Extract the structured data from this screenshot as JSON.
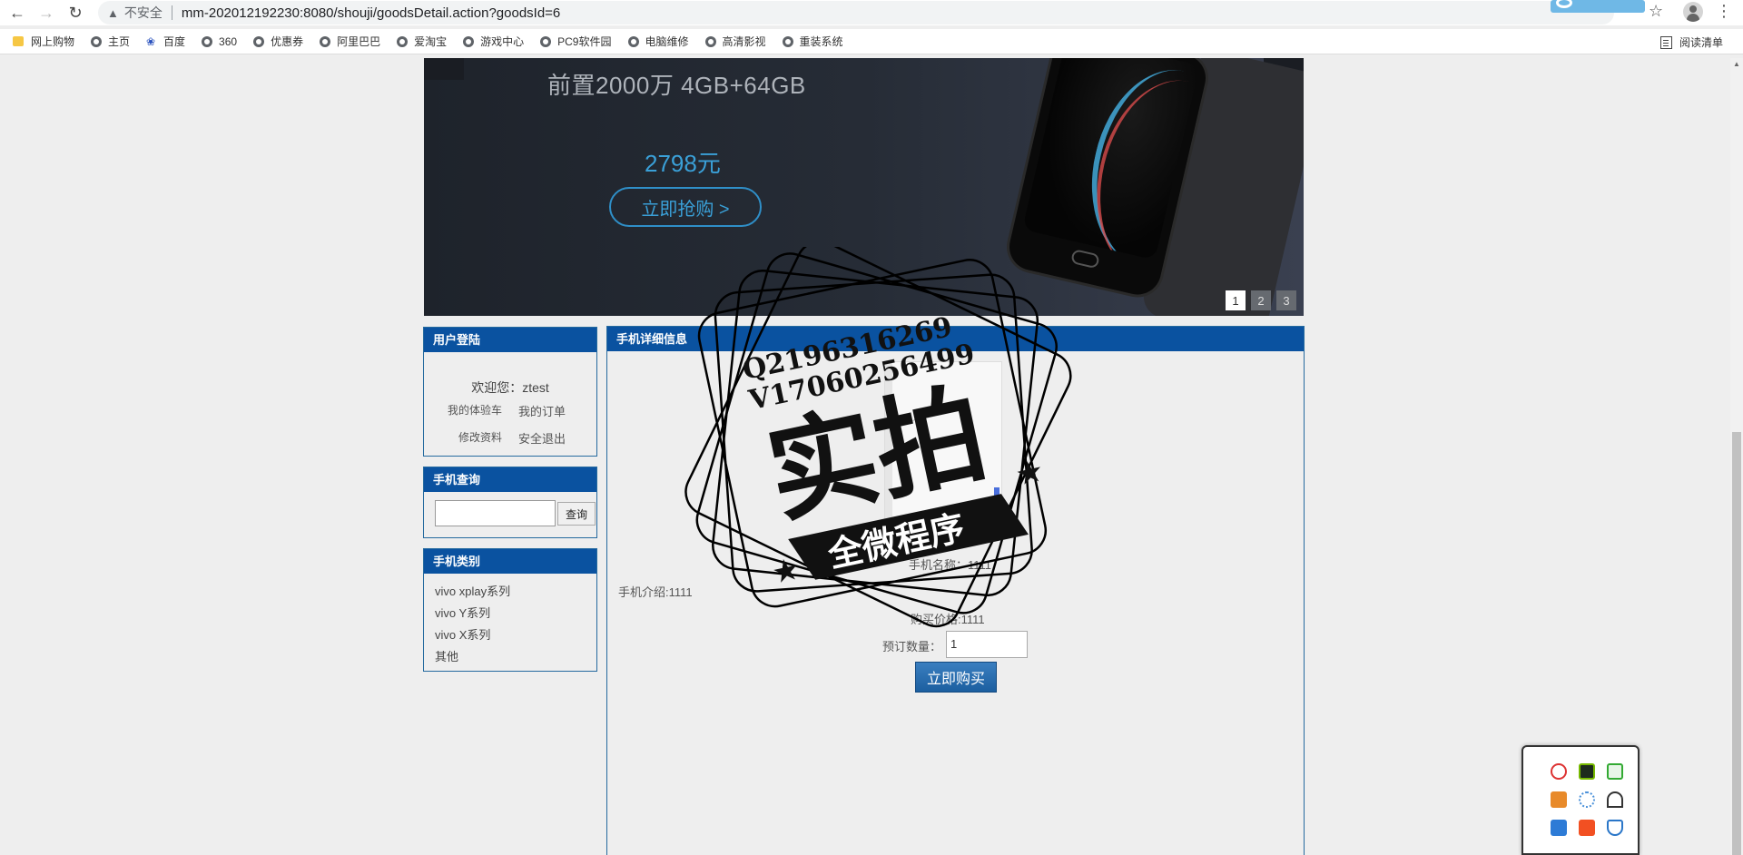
{
  "browser": {
    "insecure_label": "不安全",
    "url": "mm-202012192230:8080/shouji/goodsDetail.action?goodsId=6",
    "bookmarks": [
      "网上购物",
      "主页",
      "百度",
      "360",
      "优惠券",
      "阿里巴巴",
      "爱淘宝",
      "游戏中心",
      "PC9软件园",
      "电脑维修",
      "高清影视",
      "重装系统"
    ],
    "reading_list": "阅读清单"
  },
  "banner": {
    "spec": "前置2000万  4GB+64GB",
    "price": "2798元",
    "buy_label": "立即抢购 >",
    "pages": [
      "1",
      "2",
      "3"
    ]
  },
  "login_box": {
    "title": "用户登陆",
    "welcome": "欢迎您：ztest",
    "cart": "我的体验车",
    "orders": "我的订单",
    "edit_profile": "修改资料",
    "logout": "安全退出"
  },
  "search_box": {
    "title": "手机查询",
    "value": "",
    "button": "查询"
  },
  "category_box": {
    "title": "手机类别",
    "items": [
      "vivo xplay系列",
      "vivo Y系列",
      "vivo X系列",
      "其他"
    ]
  },
  "detail": {
    "title": "手机详细信息",
    "name": "手机名称：1111",
    "intro": "手机介绍:1111",
    "price": "购买价格:1111",
    "qty_label": "预订数量：",
    "qty_value": "1",
    "buy_button": "立即购买"
  },
  "watermark": {
    "qq": "Q2196316269",
    "wx": "V17060256499",
    "big": "实拍",
    "banner": "全微程序"
  },
  "colors": {
    "header_blue": "#0a52a0",
    "page_bg": "#eeeeee",
    "banner_accent": "#3aa0d8"
  }
}
